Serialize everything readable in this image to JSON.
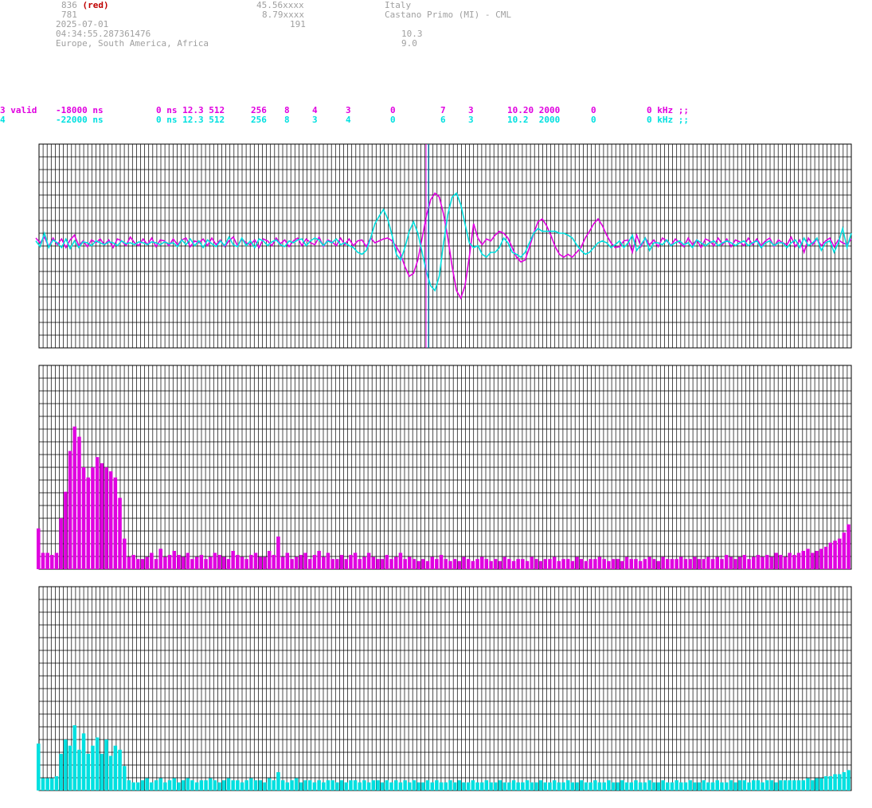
{
  "header": {
    "station_id": "836",
    "station_id_note": "(red)",
    "station_id_2": "781",
    "date": "2025-07-01",
    "time": "04:34:55.287361476",
    "region": "Europe, South America, Africa",
    "latitude": "45.56xxxx",
    "longitude": "8.79xxxx",
    "altitude": "191",
    "country": "Italy",
    "station_name": "Castano Primo (MI) - CML",
    "value_a": "10.3",
    "value_b": "9.0"
  },
  "rows": [
    {
      "color": "#e000e0",
      "c1": "3 valid",
      "c2": "-18000 ns",
      "c3": "0 ns 12.3 512",
      "c4": "256",
      "c5": "8",
      "c6": "4",
      "c7": "3",
      "c8": "0",
      "c9": "7",
      "c10": "3",
      "c11": "10.20 2000",
      "c12": "0",
      "c13": "0 kHz ;;"
    },
    {
      "color": "#00e0e0",
      "c1": "4",
      "c2": "-22000 ns",
      "c3": "0 ns 12.3 512",
      "c4": "256",
      "c5": "8",
      "c6": "3",
      "c7": "4",
      "c8": "0",
      "c9": "6",
      "c10": "3",
      "c11": "10.2  2000",
      "c12": "0",
      "c13": "0 kHz ;;"
    }
  ],
  "colors": {
    "channel_a": "#e000e0",
    "channel_b": "#00e0e0",
    "grid": "#000000",
    "marker_a": "#e000e0",
    "marker_b": "#00a0e0"
  },
  "chart_data": [
    {
      "type": "line",
      "series": [
        {
          "color": "#e000e0",
          "values": [
            0.05,
            0.0,
            0.06,
            -0.04,
            0.05,
            -0.02,
            0.04,
            -0.05,
            0.03,
            0.08,
            -0.03,
            0.02,
            -0.04,
            0.03,
            0.0,
            0.04,
            -0.02,
            0.03,
            -0.05,
            0.04,
            0.02,
            -0.03,
            0.06,
            0.0,
            -0.03,
            0.04,
            -0.02,
            0.05,
            -0.04,
            0.03,
            0.02,
            -0.03,
            0.04,
            -0.02,
            0.03,
            0.05,
            -0.04,
            0.02,
            0.0,
            0.04,
            -0.03,
            0.05,
            -0.02,
            0.03,
            -0.04,
            0.02,
            0.06,
            -0.03,
            0.04,
            0.0,
            -0.02,
            0.03,
            -0.05,
            0.04,
            0.02,
            -0.03,
            0.05,
            -0.01,
            0.03,
            -0.04,
            0.02,
            0.05,
            -0.03,
            0.04,
            0.0,
            -0.02,
            0.06,
            -0.04,
            0.03,
            0.01,
            -0.03,
            0.05,
            -0.02,
            0.04,
            -0.03,
            0.02,
            0.03,
            -0.04,
            0.05,
            0.0,
            0.02,
            0.04,
            0.05,
            0.02,
            -0.04,
            -0.12,
            -0.25,
            -0.35,
            -0.32,
            -0.18,
            0.05,
            0.28,
            0.45,
            0.52,
            0.48,
            0.3,
            0.05,
            -0.25,
            -0.5,
            -0.58,
            -0.45,
            -0.15,
            0.2,
            0.05,
            -0.02,
            0.04,
            0.02,
            0.08,
            0.12,
            0.1,
            0.05,
            -0.05,
            -0.15,
            -0.2,
            -0.18,
            -0.05,
            0.1,
            0.22,
            0.25,
            0.18,
            0.08,
            -0.04,
            -0.12,
            -0.15,
            -0.12,
            -0.15,
            -0.1,
            -0.05,
            0.05,
            0.12,
            0.2,
            0.25,
            0.18,
            0.08,
            0.0,
            -0.05,
            -0.04,
            0.02,
            0.03,
            -0.1,
            0.08,
            -0.04,
            0.05,
            -0.02,
            0.03,
            -0.04,
            0.05,
            0.02,
            -0.03,
            0.04,
            0.0,
            -0.04,
            0.05,
            -0.02,
            0.03,
            -0.05,
            0.04,
            0.02,
            -0.03,
            0.05,
            -0.02,
            0.04,
            -0.04,
            0.03,
            0.01,
            -0.03,
            0.05,
            -0.02,
            0.04,
            -0.03,
            0.02,
            0.05,
            -0.04,
            0.03,
            0.0,
            -0.02,
            0.06,
            -0.04,
            0.03,
            -0.1,
            0.05,
            -0.02,
            0.04,
            -0.03,
            0.02,
            0.05,
            -0.04,
            0.03,
            0.0,
            -0.02,
            0.04
          ]
        },
        {
          "color": "#00e0e0",
          "values": [
            0.02,
            -0.04,
            0.1,
            -0.05,
            0.03,
            0.0,
            -0.05,
            0.04,
            -0.06,
            0.02,
            -0.05,
            0.01,
            0.0,
            -0.03,
            0.02,
            0.0,
            -0.02,
            0.01,
            0.0,
            -0.03,
            0.02,
            -0.01,
            0.0,
            -0.02,
            0.01,
            0.0,
            -0.02,
            0.01,
            0.0,
            -0.02,
            0.01,
            -0.01,
            0.0,
            -0.04,
            0.03,
            -0.02,
            0.04,
            -0.03,
            0.02,
            -0.05,
            0.03,
            -0.01,
            -0.04,
            0.02,
            -0.03,
            0.06,
            -0.02,
            -0.04,
            0.05,
            -0.03,
            0.02,
            -0.05,
            0.04,
            0.02,
            -0.03,
            0.01,
            0.03,
            -0.02,
            -0.04,
            0.02,
            0.0,
            0.03,
            0.04,
            -0.03,
            0.02,
            0.05,
            0.03,
            -0.03,
            0.02,
            0.0,
            0.04,
            -0.02,
            0.0,
            -0.03,
            -0.05,
            -0.1,
            -0.12,
            -0.08,
            0.05,
            0.2,
            0.28,
            0.35,
            0.25,
            0.08,
            -0.12,
            -0.18,
            -0.05,
            0.12,
            0.22,
            0.1,
            -0.1,
            -0.3,
            -0.45,
            -0.5,
            -0.35,
            0.0,
            0.3,
            0.48,
            0.52,
            0.4,
            0.2,
            0.0,
            -0.05,
            -0.03,
            -0.12,
            -0.15,
            -0.1,
            -0.1,
            -0.05,
            0.05,
            0.0,
            -0.1,
            -0.12,
            -0.15,
            -0.1,
            0.0,
            0.1,
            0.15,
            0.12,
            0.12,
            0.12,
            0.12,
            0.1,
            0.1,
            0.08,
            0.05,
            -0.02,
            -0.08,
            -0.12,
            -0.1,
            -0.05,
            0.0,
            0.02,
            0.0,
            -0.05,
            -0.02,
            0.02,
            -0.05,
            0.0,
            0.08,
            -0.08,
            -0.02,
            0.05,
            -0.08,
            0.0,
            0.0,
            -0.02,
            0.03,
            -0.03,
            0.0,
            0.02,
            -0.02,
            0.0,
            -0.05,
            0.03,
            0.0,
            -0.03,
            0.0,
            0.02,
            -0.03,
            0.0,
            0.02,
            0.0,
            -0.03,
            0.0,
            0.02,
            -0.03,
            0.0,
            0.02,
            -0.05,
            0.0,
            0.02,
            -0.03,
            0.0,
            0.0,
            -0.05,
            0.0,
            0.03,
            -0.05,
            0.05,
            -0.03,
            0.0,
            0.05,
            -0.08,
            0.0,
            0.02,
            -0.1,
            0.0,
            0.15,
            -0.05,
            0.1
          ]
        }
      ]
    },
    {
      "type": "bar",
      "series": [
        {
          "color": "#e000e0",
          "values": [
            0.2,
            0.08,
            0.08,
            0.07,
            0.08,
            0.25,
            0.38,
            0.58,
            0.7,
            0.65,
            0.5,
            0.45,
            0.5,
            0.55,
            0.52,
            0.5,
            0.48,
            0.45,
            0.35,
            0.15,
            0.06,
            0.07,
            0.05,
            0.05,
            0.06,
            0.08,
            0.05,
            0.1,
            0.06,
            0.07,
            0.09,
            0.07,
            0.06,
            0.08,
            0.05,
            0.06,
            0.07,
            0.05,
            0.06,
            0.08,
            0.07,
            0.06,
            0.05,
            0.09,
            0.07,
            0.06,
            0.05,
            0.07,
            0.08,
            0.06,
            0.06,
            0.09,
            0.07,
            0.16,
            0.06,
            0.08,
            0.05,
            0.06,
            0.07,
            0.08,
            0.05,
            0.07,
            0.09,
            0.06,
            0.08,
            0.05,
            0.05,
            0.07,
            0.05,
            0.07,
            0.08,
            0.05,
            0.06,
            0.08,
            0.06,
            0.05,
            0.05,
            0.07,
            0.05,
            0.06,
            0.08,
            0.05,
            0.06,
            0.05,
            0.04,
            0.05,
            0.04,
            0.06,
            0.05,
            0.07,
            0.05,
            0.04,
            0.05,
            0.04,
            0.06,
            0.05,
            0.04,
            0.05,
            0.06,
            0.05,
            0.04,
            0.05,
            0.04,
            0.06,
            0.05,
            0.04,
            0.05,
            0.05,
            0.04,
            0.06,
            0.05,
            0.04,
            0.05,
            0.05,
            0.06,
            0.04,
            0.05,
            0.05,
            0.04,
            0.06,
            0.05,
            0.04,
            0.05,
            0.05,
            0.06,
            0.05,
            0.04,
            0.05,
            0.05,
            0.04,
            0.06,
            0.05,
            0.05,
            0.04,
            0.05,
            0.06,
            0.05,
            0.04,
            0.06,
            0.05,
            0.05,
            0.05,
            0.06,
            0.05,
            0.05,
            0.06,
            0.05,
            0.05,
            0.06,
            0.05,
            0.06,
            0.05,
            0.07,
            0.06,
            0.05,
            0.06,
            0.07,
            0.05,
            0.06,
            0.07,
            0.06,
            0.07,
            0.06,
            0.08,
            0.07,
            0.06,
            0.08,
            0.07,
            0.08,
            0.09,
            0.1,
            0.08,
            0.09,
            0.1,
            0.11,
            0.13,
            0.14,
            0.15,
            0.18,
            0.22
          ]
        }
      ]
    },
    {
      "type": "bar",
      "series": [
        {
          "color": "#00e0e0",
          "values": [
            0.23,
            0.06,
            0.06,
            0.06,
            0.07,
            0.18,
            0.25,
            0.22,
            0.32,
            0.2,
            0.28,
            0.18,
            0.22,
            0.26,
            0.18,
            0.25,
            0.17,
            0.22,
            0.2,
            0.12,
            0.05,
            0.04,
            0.04,
            0.05,
            0.06,
            0.04,
            0.05,
            0.06,
            0.04,
            0.05,
            0.06,
            0.04,
            0.05,
            0.06,
            0.05,
            0.04,
            0.05,
            0.05,
            0.06,
            0.05,
            0.04,
            0.05,
            0.06,
            0.05,
            0.05,
            0.04,
            0.05,
            0.06,
            0.05,
            0.05,
            0.04,
            0.06,
            0.05,
            0.09,
            0.05,
            0.04,
            0.05,
            0.06,
            0.04,
            0.05,
            0.05,
            0.04,
            0.05,
            0.04,
            0.05,
            0.05,
            0.04,
            0.05,
            0.04,
            0.05,
            0.05,
            0.04,
            0.05,
            0.04,
            0.05,
            0.05,
            0.04,
            0.05,
            0.04,
            0.05,
            0.04,
            0.05,
            0.04,
            0.05,
            0.04,
            0.04,
            0.05,
            0.04,
            0.05,
            0.04,
            0.04,
            0.05,
            0.04,
            0.05,
            0.04,
            0.04,
            0.05,
            0.04,
            0.04,
            0.05,
            0.04,
            0.04,
            0.05,
            0.04,
            0.04,
            0.05,
            0.04,
            0.04,
            0.05,
            0.04,
            0.04,
            0.05,
            0.04,
            0.04,
            0.05,
            0.04,
            0.04,
            0.05,
            0.04,
            0.04,
            0.05,
            0.04,
            0.04,
            0.05,
            0.04,
            0.04,
            0.05,
            0.04,
            0.04,
            0.05,
            0.04,
            0.04,
            0.05,
            0.04,
            0.04,
            0.05,
            0.04,
            0.04,
            0.05,
            0.04,
            0.04,
            0.05,
            0.04,
            0.04,
            0.05,
            0.04,
            0.04,
            0.05,
            0.04,
            0.04,
            0.05,
            0.04,
            0.04,
            0.05,
            0.04,
            0.05,
            0.05,
            0.04,
            0.05,
            0.05,
            0.04,
            0.05,
            0.05,
            0.04,
            0.05,
            0.05,
            0.05,
            0.05,
            0.05,
            0.05,
            0.06,
            0.05,
            0.06,
            0.06,
            0.07,
            0.07,
            0.08,
            0.08,
            0.09,
            0.1
          ]
        }
      ]
    }
  ]
}
